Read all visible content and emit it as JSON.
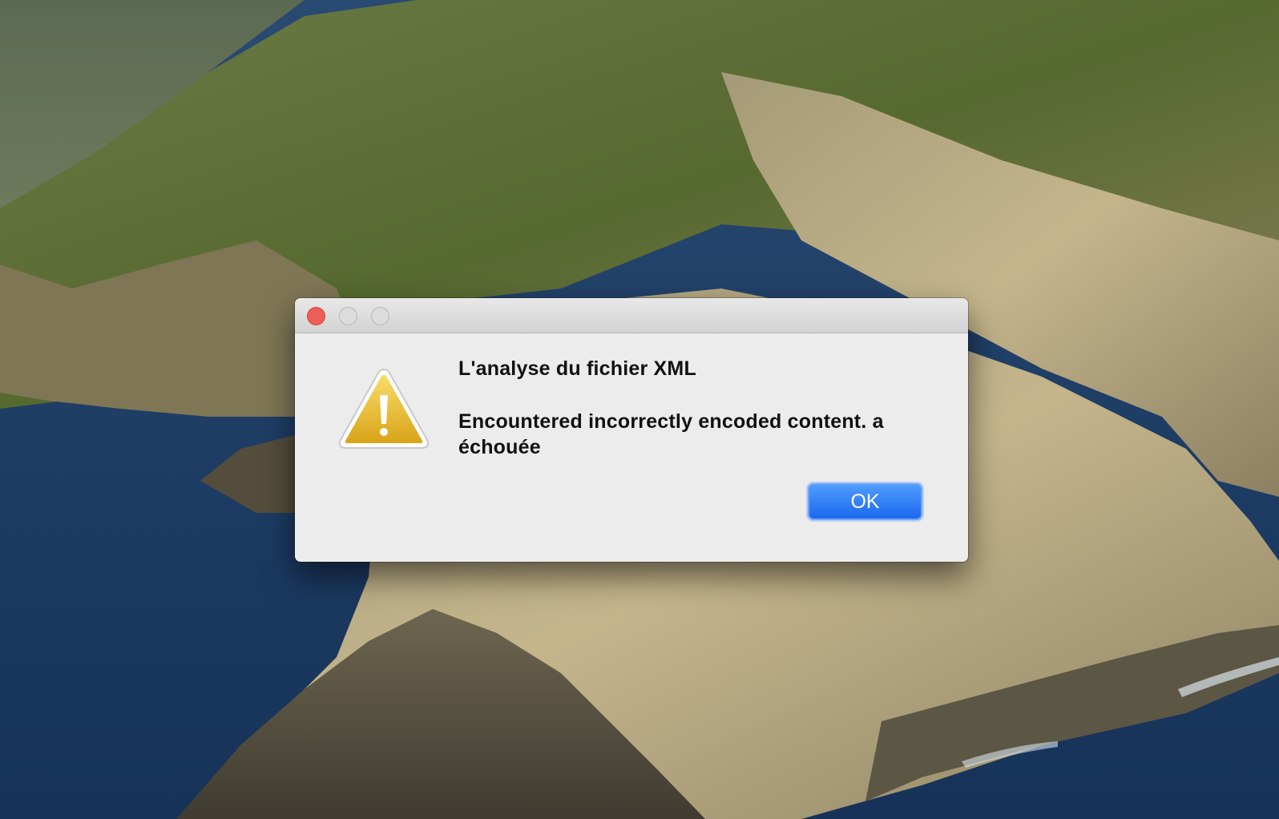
{
  "dialog": {
    "title": "L'analyse du fichier XML",
    "message": "Encountered incorrectly encoded content. a échouée",
    "ok_label": "OK",
    "icon": "warning-icon"
  },
  "window_controls": {
    "close": "close-button",
    "minimize": "minimize-button",
    "zoom": "zoom-button"
  },
  "colors": {
    "close_button": "#ee5d56",
    "ok_button": "#1c68ee",
    "dialog_background": "#ececec",
    "warning_icon": "#f2c230"
  }
}
